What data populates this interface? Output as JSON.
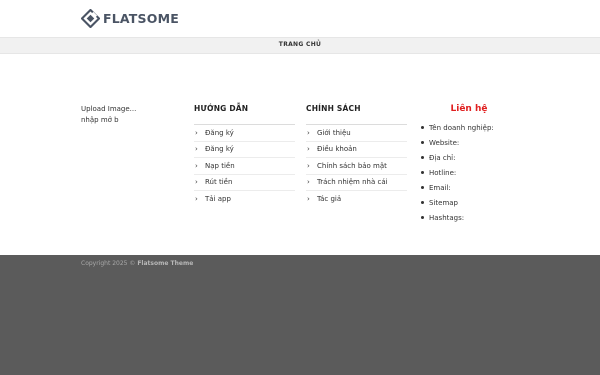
{
  "brand": {
    "logo_text": "FLATSOME"
  },
  "nav": {
    "items": [
      {
        "label": "TRANG CHỦ"
      }
    ]
  },
  "widgets": {
    "col1": {
      "lines": [
        "Upload Image...",
        "nhập mở b"
      ]
    },
    "guide": {
      "title": "HƯỚNG DẪN",
      "items": [
        "Đăng ký",
        "Đăng ký",
        "Nạp tiền",
        "Rút tiền",
        "Tải app"
      ]
    },
    "policy": {
      "title": "CHÍNH SÁCH",
      "items": [
        "Giới thiệu",
        "Điều khoản",
        "Chính sách bảo mật",
        "Trách nhiệm nhà cái",
        "Tác giả"
      ]
    },
    "contact": {
      "title": "Liên hệ",
      "items": [
        "Tên doanh nghiệp:",
        "Website:",
        "Địa chỉ:",
        "Hotline:",
        "Email:",
        "Sitemap",
        "Hashtags:"
      ]
    }
  },
  "footer": {
    "copyright_prefix": "Copyright 2025 ©",
    "copyright_brand": "Flatsome Theme"
  },
  "colors": {
    "accent_red": "#e02020",
    "footer_bg": "#5b5b5b",
    "nav_bg": "#f1f1f1",
    "logo": "#4a5464"
  },
  "icons": {
    "logo": "flatsome-logo-icon",
    "menu_bullet": "chevron-right-icon",
    "contact_bullet": "bullet-dot-icon"
  }
}
